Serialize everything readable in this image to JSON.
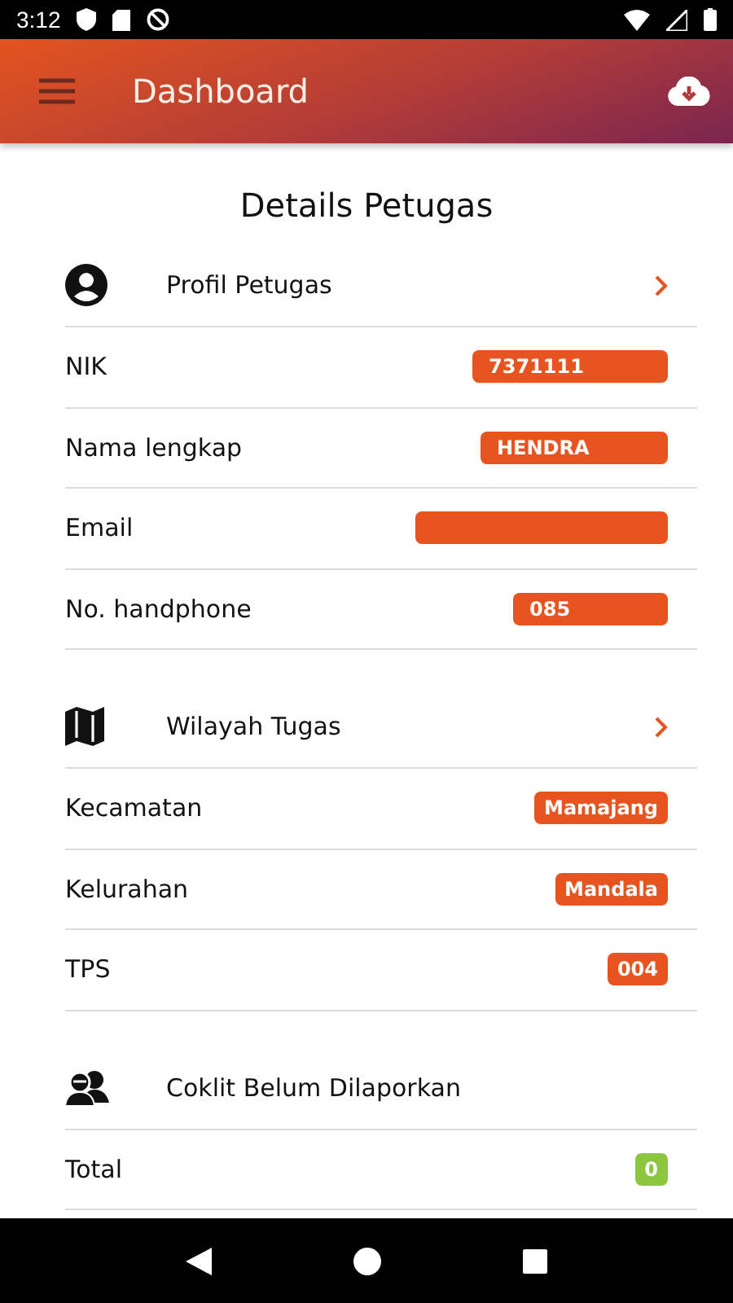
{
  "status_bar": {
    "time": "3:12"
  },
  "app_bar": {
    "title": "Dashboard"
  },
  "page_title": "Details Petugas",
  "sections": [
    {
      "kind": "profile",
      "title": "Profil Petugas",
      "has_chevron": true,
      "rows": [
        {
          "label": "NIK",
          "value": "7371111",
          "redacted": true,
          "color": "#e8541f"
        },
        {
          "label": "Nama lengkap",
          "value": "HENDRA",
          "redacted": true,
          "color": "#e8541f"
        },
        {
          "label": "Email",
          "redacted": true,
          "color": "#e8541f"
        },
        {
          "label": "No. handphone",
          "value": "085",
          "redacted": true,
          "color": "#e8541f"
        }
      ]
    },
    {
      "kind": "region",
      "title": "Wilayah Tugas",
      "has_chevron": true,
      "rows": [
        {
          "label": "Kecamatan",
          "value": "Mamajang",
          "redacted": false,
          "color": "#e8541f"
        },
        {
          "label": "Kelurahan",
          "value": "Mandala",
          "redacted": false,
          "color": "#e8541f"
        },
        {
          "label": "TPS",
          "value": "004",
          "redacted": false,
          "color": "#e8541f"
        }
      ]
    },
    {
      "kind": "report",
      "title": "Coklit Belum Dilaporkan",
      "has_chevron": false,
      "rows": [
        {
          "label": "Total",
          "value": "0",
          "redacted": false,
          "color": "#8cc63f"
        }
      ]
    }
  ]
}
